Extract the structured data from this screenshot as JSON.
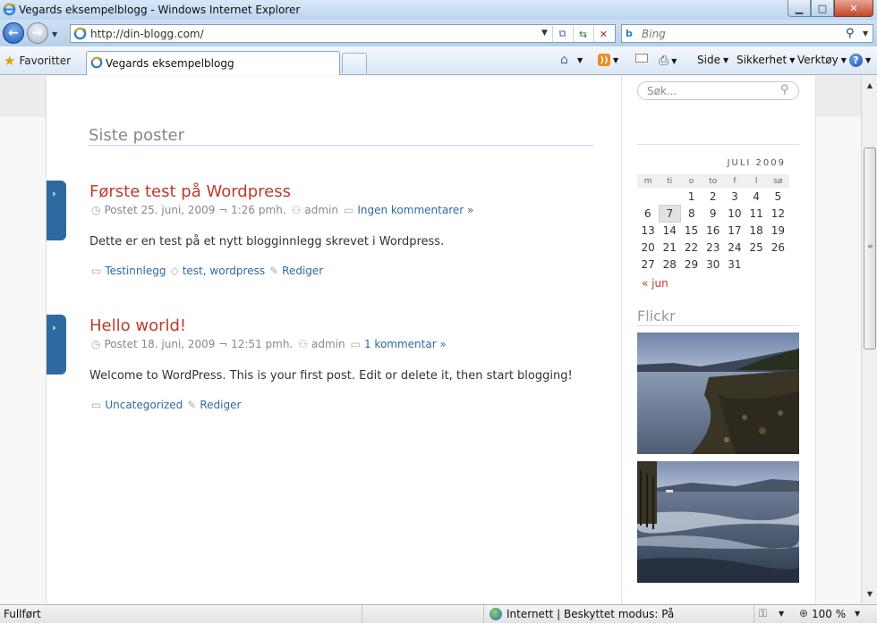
{
  "browser": {
    "window_title": "Vegards eksempelblogg - Windows Internet Explorer",
    "address_url": "http://din-blogg.com/",
    "search_placeholder": "Bing",
    "favorites_label": "Favoritter",
    "active_tab_title": "Vegards eksempelblogg",
    "commands": {
      "side": "Side",
      "sikkerhet": "Sikkerhet",
      "verktoy": "Verktøy"
    },
    "status": {
      "left": "Fullført",
      "zone": "Internett | Beskyttet modus: På",
      "zoom": "100 %"
    }
  },
  "site": {
    "search_placeholder": "Søk...",
    "section_title": "Siste poster",
    "posts": [
      {
        "title": "Første test på Wordpress",
        "posted": "Postet 25. juni, 2009 ¬ 1:26 pmh.",
        "author": "admin",
        "comments": "Ingen kommentarer »",
        "body": "Dette er en test på et nytt blogginnlegg skrevet i Wordpress.",
        "category": "Testinnlegg",
        "tags": [
          "test",
          "wordpress"
        ],
        "edit": "Rediger"
      },
      {
        "title": "Hello world!",
        "posted": "Postet 18. juni, 2009 ¬ 12:51 pmh.",
        "author": "admin",
        "comments": "1 kommentar »",
        "body": "Welcome to WordPress. This is your first post. Edit or delete it, then start blogging!",
        "category": "Uncategorized",
        "edit": "Rediger"
      }
    ],
    "calendar": {
      "caption": "JULI 2009",
      "weekdays": [
        "m",
        "ti",
        "o",
        "to",
        "f",
        "l",
        "sø"
      ],
      "weeks": [
        [
          "",
          "",
          "1",
          "2",
          "3",
          "4",
          "5"
        ],
        [
          "6",
          "7",
          "8",
          "9",
          "10",
          "11",
          "12"
        ],
        [
          "13",
          "14",
          "15",
          "16",
          "17",
          "18",
          "19"
        ],
        [
          "20",
          "21",
          "22",
          "23",
          "24",
          "25",
          "26"
        ],
        [
          "27",
          "28",
          "29",
          "30",
          "31",
          "",
          ""
        ]
      ],
      "highlighted_day": "7",
      "prev_link": "« jun"
    },
    "flickr": {
      "title": "Flickr",
      "photos": [
        "lake-shore-evening",
        "pier-waves-evening"
      ]
    }
  },
  "colors": {
    "post_title": "#c0392b",
    "link": "#2e6aa1",
    "post_tab": "#2e6aa1"
  }
}
